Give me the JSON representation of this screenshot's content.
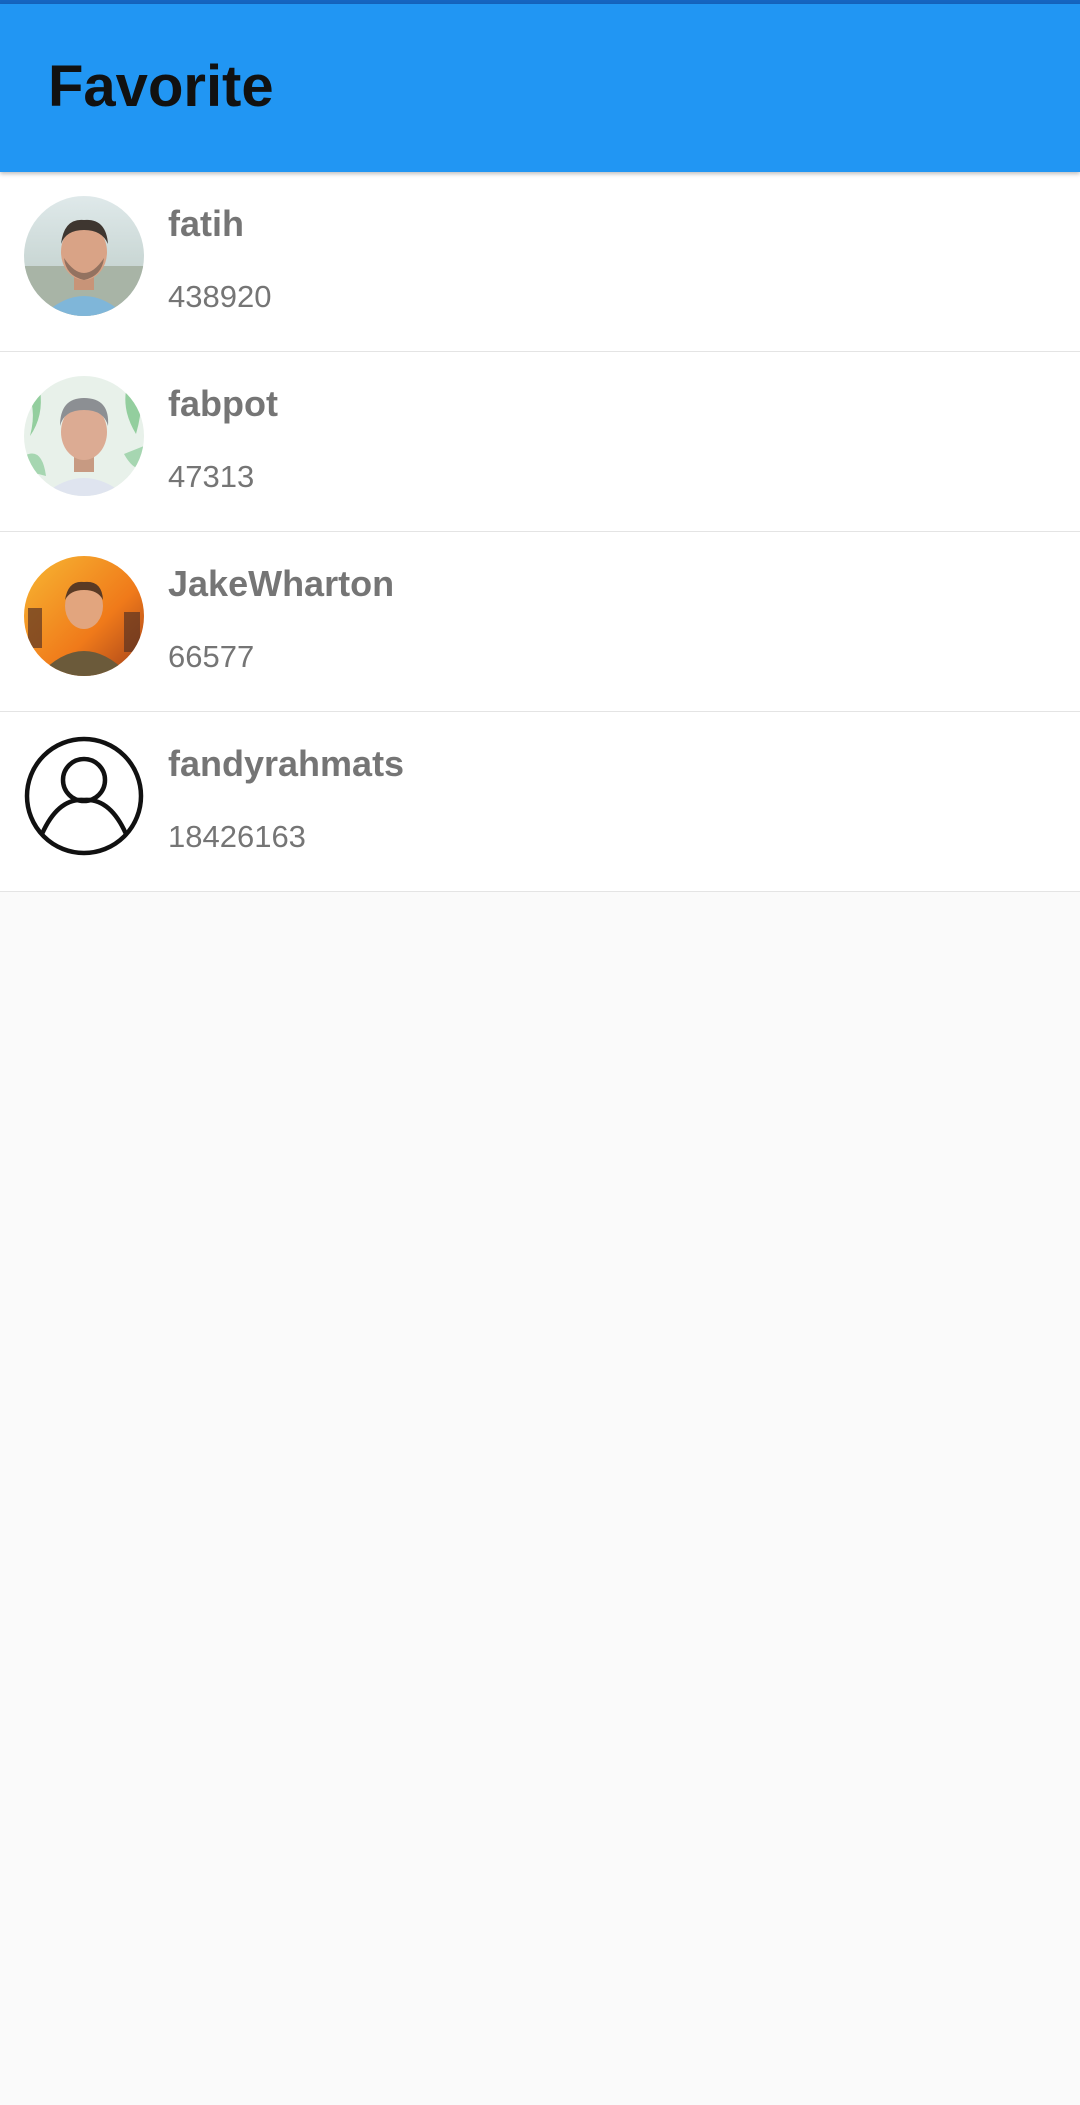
{
  "app_bar": {
    "title": "Favorite",
    "color": "#2196f3"
  },
  "favorites": [
    {
      "username": "fatih",
      "id": "438920",
      "avatar": "photo"
    },
    {
      "username": "fabpot",
      "id": "47313",
      "avatar": "photo"
    },
    {
      "username": "JakeWharton",
      "id": "66577",
      "avatar": "photo"
    },
    {
      "username": "fandyrahmats",
      "id": "18426163",
      "avatar": "user-placeholder-icon"
    }
  ]
}
